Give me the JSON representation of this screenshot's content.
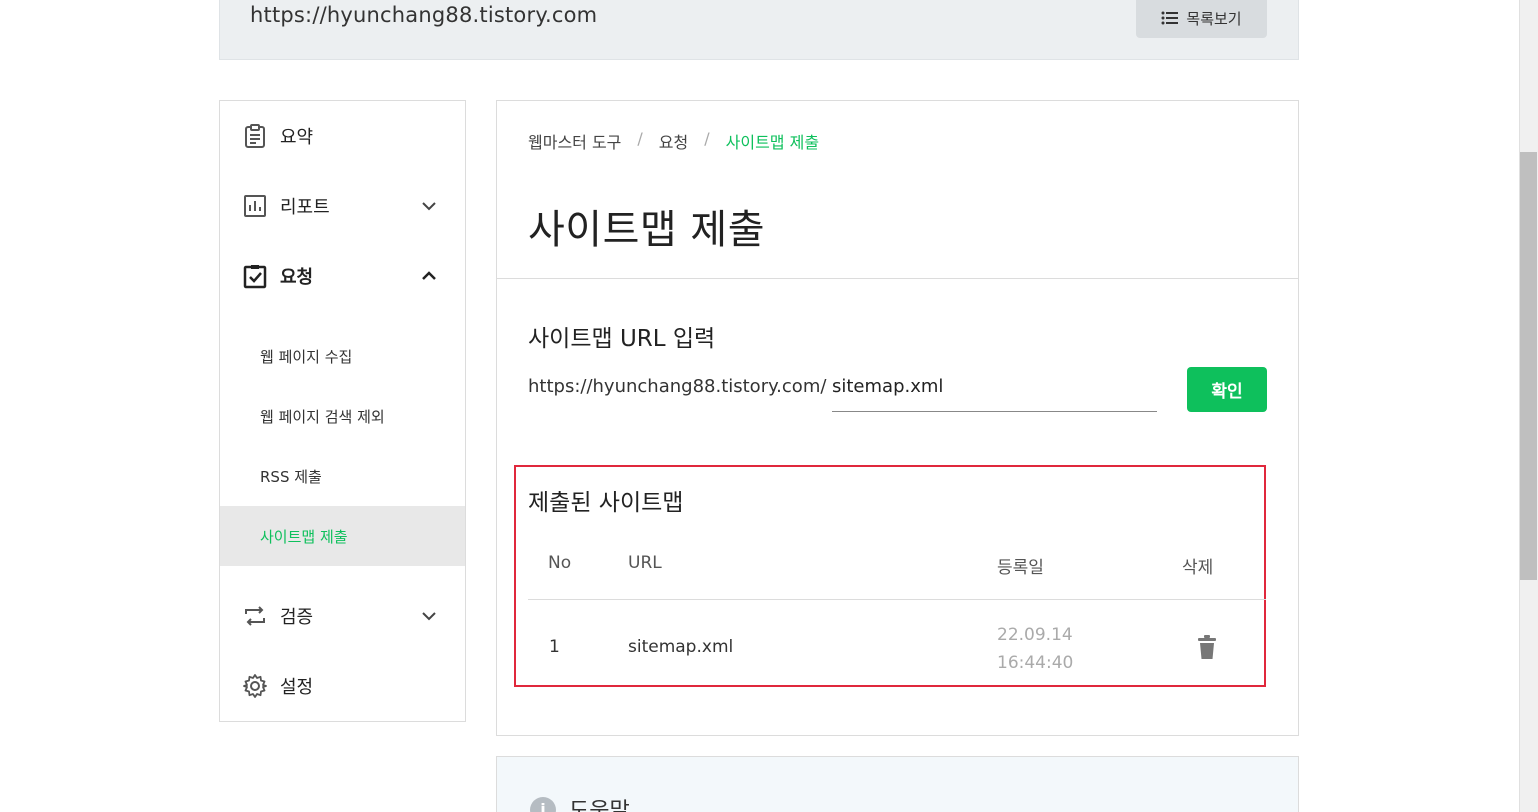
{
  "header": {
    "site_url": "https://hyunchang88.tistory.com",
    "list_button_label": "목록보기"
  },
  "sidebar": {
    "items": [
      {
        "label": "요약",
        "icon": "clipboard-icon"
      },
      {
        "label": "리포트",
        "icon": "chart-icon"
      },
      {
        "label": "요청",
        "icon": "clipboard-check-icon"
      },
      {
        "label": "검증",
        "icon": "repeat-icon"
      },
      {
        "label": "설정",
        "icon": "gear-icon"
      }
    ],
    "sub_items": [
      {
        "label": "웹 페이지 수집"
      },
      {
        "label": "웹 페이지 검색 제외"
      },
      {
        "label": "RSS 제출"
      },
      {
        "label": "사이트맵 제출"
      }
    ]
  },
  "breadcrumb": {
    "items": [
      "웹마스터 도구",
      "요청",
      "사이트맵 제출"
    ],
    "separator": "/"
  },
  "page": {
    "title": "사이트맵 제출"
  },
  "sitemap_form": {
    "title": "사이트맵 URL 입력",
    "url_prefix": "https://hyunchang88.tistory.com/",
    "input_value": "sitemap.xml",
    "confirm_label": "확인"
  },
  "submitted": {
    "title": "제출된 사이트맵",
    "columns": [
      "No",
      "URL",
      "등록일",
      "삭제"
    ],
    "rows": [
      {
        "no": "1",
        "url": "sitemap.xml",
        "date": "22.09.14 16:44:40"
      }
    ]
  },
  "help": {
    "label": "도움말"
  },
  "colors": {
    "accent": "#0ec05c",
    "highlight_border": "#e0283c"
  }
}
